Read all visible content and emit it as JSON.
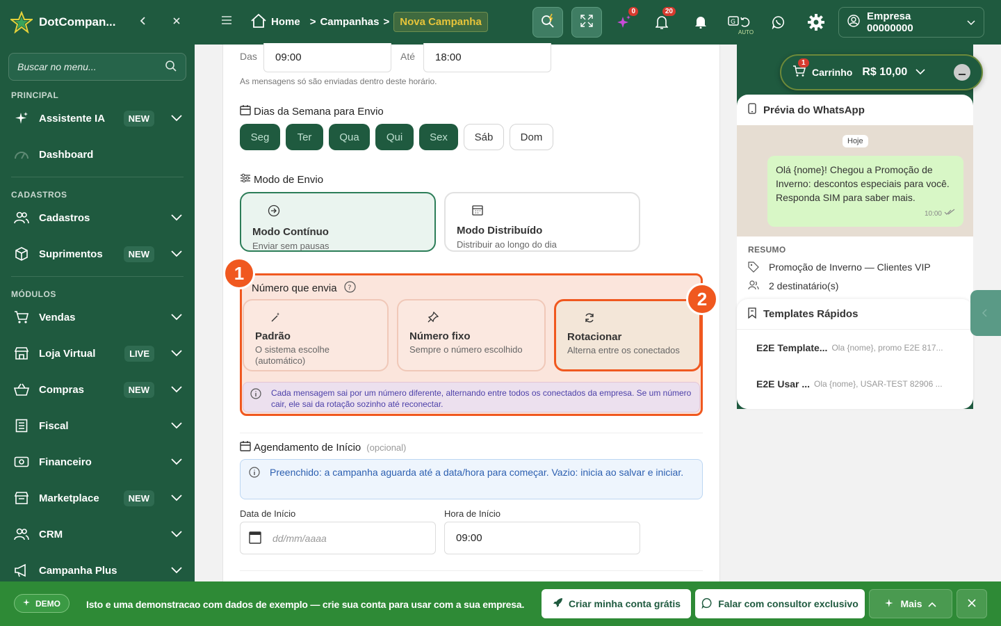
{
  "sidebar": {
    "brand": "DotCompan...",
    "search_placeholder": "Buscar no menu...",
    "sections": {
      "principal": "PRINCIPAL",
      "cadastros": "CADASTROS",
      "modulos": "MÓDULOS"
    },
    "items": [
      {
        "label": "Assistente IA",
        "badge": "NEW",
        "icon": "sparkles-icon"
      },
      {
        "label": "Dashboard",
        "badge": "",
        "icon": "gauge-icon"
      },
      {
        "label": "Cadastros",
        "badge": "",
        "icon": "users-icon"
      },
      {
        "label": "Suprimentos",
        "badge": "NEW",
        "icon": "box-icon"
      },
      {
        "label": "Vendas",
        "badge": "",
        "icon": "cart-icon"
      },
      {
        "label": "Loja Virtual",
        "badge": "LIVE",
        "icon": "store-icon"
      },
      {
        "label": "Compras",
        "badge": "NEW",
        "icon": "basket-icon"
      },
      {
        "label": "Fiscal",
        "badge": "",
        "icon": "document-icon"
      },
      {
        "label": "Financeiro",
        "badge": "",
        "icon": "money-icon"
      },
      {
        "label": "Marketplace",
        "badge": "NEW",
        "icon": "shop-icon"
      },
      {
        "label": "CRM",
        "badge": "",
        "icon": "users-icon"
      },
      {
        "label": "Campanha Plus",
        "badge": "",
        "icon": "megaphone-icon"
      }
    ]
  },
  "topbar": {
    "breadcrumb": {
      "home": "Home",
      "campanhas": "Campanhas",
      "current": "Nova Campanha"
    },
    "ai_count": "0",
    "notif_count": "20",
    "auto_label": "AUTO",
    "empresa": "Empresa 00000000"
  },
  "form": {
    "hours": {
      "from_label": "Das",
      "from_value": "09:00",
      "to_label": "Até",
      "to_value": "18:00",
      "hint": "As mensagens só são enviadas dentro deste horário."
    },
    "days_title": "Dias da Semana para Envio",
    "days": [
      {
        "label": "Seg",
        "active": true
      },
      {
        "label": "Ter",
        "active": true
      },
      {
        "label": "Qua",
        "active": true
      },
      {
        "label": "Qui",
        "active": true
      },
      {
        "label": "Sex",
        "active": true
      },
      {
        "label": "Sáb",
        "active": false
      },
      {
        "label": "Dom",
        "active": false
      }
    ],
    "mode_title": "Modo de Envio",
    "modes": [
      {
        "title": "Modo Contínuo",
        "subtitle": "Enviar sem pausas",
        "selected": true
      },
      {
        "title": "Modo Distribuído",
        "subtitle": "Distribuir ao longo do dia",
        "selected": false
      }
    ],
    "sender_title": "Número que envia",
    "sender_options": [
      {
        "title": "Padrão",
        "subtitle": "O sistema escolhe (automático)"
      },
      {
        "title": "Número fixo",
        "subtitle": "Sempre o número escolhido"
      },
      {
        "title": "Rotacionar",
        "subtitle": "Alterna entre os conectados"
      }
    ],
    "sender_info": "Cada mensagem sai por um número diferente, alternando entre todos os conectados da empresa. Se um número cair, ele sai da rotação sozinho até reconectar.",
    "schedule_title": "Agendamento de Início",
    "schedule_optional": "(opcional)",
    "schedule_info": "Preenchido: a campanha aguarda até a data/hora para começar. Vazio: inicia ao salvar e iniciar.",
    "start_date_label": "Data de Início",
    "start_date_placeholder": "dd/mm/aaaa",
    "start_time_label": "Hora de Início",
    "start_time_value": "09:00"
  },
  "annotations": [
    "1",
    "2"
  ],
  "cart": {
    "label": "Carrinho",
    "count": "1",
    "total": "R$ 10,00"
  },
  "preview": {
    "title": "Prévia do WhatsApp",
    "day": "Hoje",
    "message": "Olá {nome}! Chegou a Promoção de Inverno: descontos especiais para você. Responda SIM para saber mais.",
    "time": "10:00",
    "summary_title": "RESUMO",
    "campaign": "Promoção de Inverno — Clientes VIP",
    "recipients": "2 destinatário(s)"
  },
  "templates": {
    "title": "Templates Rápidos",
    "items": [
      {
        "name": "E2E Template...",
        "preview": "Ola {nome}, promo E2E 817..."
      },
      {
        "name": "E2E Usar ...",
        "preview": "Ola {nome}, USAR-TEST 82906 ..."
      }
    ]
  },
  "banner": {
    "demo": "DEMO",
    "text": "Isto e uma demonstracao com dados de exemplo — crie sua conta para usar com a sua empresa.",
    "create_account": "Criar minha conta grátis",
    "consultant": "Falar com consultor exclusivo",
    "more": "Mais"
  },
  "colors": {
    "brand_green": "#1f5a3f",
    "accent_orange": "#f0581f",
    "banner_green": "#2e8a36",
    "yellow": "#e7c43a"
  }
}
